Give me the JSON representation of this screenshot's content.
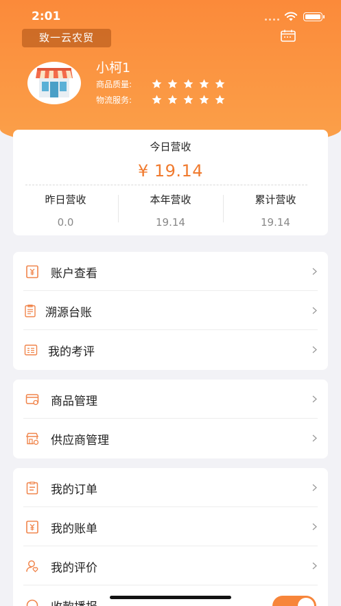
{
  "status_bar": {
    "time": "2:01"
  },
  "header": {
    "app_badge": "致一云农贸",
    "store_name": "小柯1",
    "ratings": [
      {
        "label": "商品质量:",
        "stars": 5
      },
      {
        "label": "物流服务:",
        "stars": 5
      }
    ]
  },
  "revenue": {
    "title": "今日营收",
    "amount": "¥ 19.14",
    "stats": [
      {
        "label": "昨日营收",
        "value": "0.0"
      },
      {
        "label": "本年营收",
        "value": "19.14"
      },
      {
        "label": "累计营收",
        "value": "19.14"
      }
    ]
  },
  "menu_groups": [
    {
      "items": [
        {
          "label": "账户查看",
          "icon": "account-ledger-icon"
        },
        {
          "label": "溯源台账",
          "icon": "trace-clipboard-icon"
        },
        {
          "label": "我的考评",
          "icon": "evaluation-card-icon"
        }
      ]
    },
    {
      "items": [
        {
          "label": "商品管理",
          "icon": "goods-card-icon"
        },
        {
          "label": "供应商管理",
          "icon": "supplier-store-icon"
        }
      ]
    },
    {
      "items": [
        {
          "label": "我的订单",
          "icon": "order-clipboard-icon"
        },
        {
          "label": "我的账单",
          "icon": "bill-ledger-icon"
        },
        {
          "label": "我的评价",
          "icon": "review-user-icon"
        },
        {
          "label": "收款播报",
          "icon": "broadcast-icon",
          "toggle": true
        }
      ]
    }
  ],
  "colors": {
    "accent": "#f7853a",
    "header_top": "#fb8a3a",
    "header_bottom": "#fba14a"
  }
}
